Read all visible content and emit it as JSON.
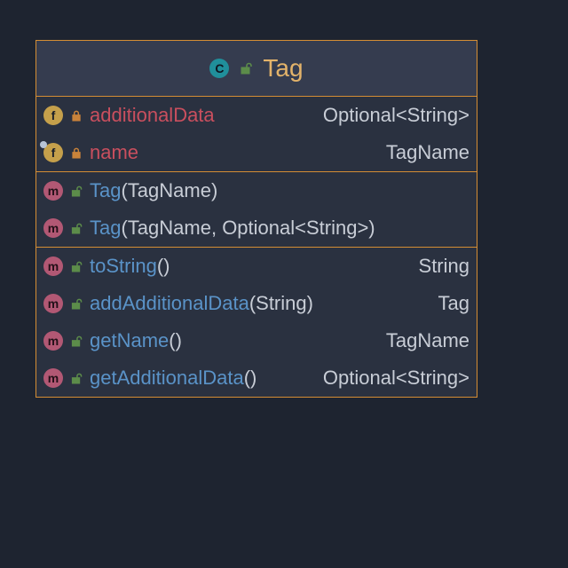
{
  "class": {
    "name": "Tag",
    "visibility": "public"
  },
  "fields": [
    {
      "kind": "f",
      "visibility": "private",
      "name": "additionalData",
      "type": "Optional<String>",
      "abstract": false
    },
    {
      "kind": "f",
      "visibility": "private",
      "name": "name",
      "type": "TagName",
      "abstract": true
    }
  ],
  "constructors": [
    {
      "kind": "m",
      "visibility": "public",
      "name": "Tag",
      "params": "(TagName)"
    },
    {
      "kind": "m",
      "visibility": "public",
      "name": "Tag",
      "params": "(TagName, Optional<String>)"
    }
  ],
  "methods": [
    {
      "kind": "m",
      "visibility": "public",
      "name": "toString",
      "params": "()",
      "returns": "String"
    },
    {
      "kind": "m",
      "visibility": "public",
      "name": "addAdditionalData",
      "params": "(String)",
      "returns": "Tag"
    },
    {
      "kind": "m",
      "visibility": "public",
      "name": "getName",
      "params": "()",
      "returns": "TagName"
    },
    {
      "kind": "m",
      "visibility": "public",
      "name": "getAdditionalData",
      "params": "()",
      "returns": "Optional<String>"
    }
  ],
  "colors": {
    "border": "#d48d34",
    "classIcon": "#208f9b",
    "fieldIcon": "#c5a04b",
    "methodIcon": "#b25874",
    "privateLock": "#c9833a",
    "publicLock": "#5c8c4a",
    "fieldName": "#c94f5e",
    "methodName": "#5a93c8",
    "typeText": "#c8cdd6"
  }
}
